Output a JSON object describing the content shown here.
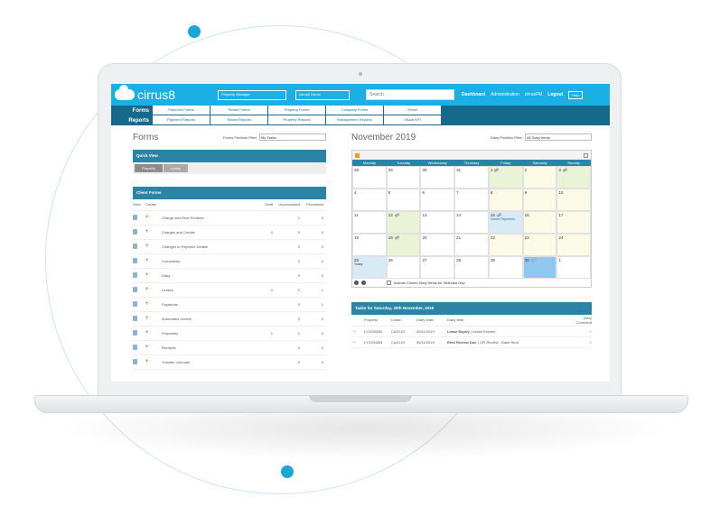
{
  "topbar": {
    "logo": "cirrus8",
    "portfolio_select": "Property Manager",
    "user_select": "cirrus8 Demo",
    "search_placeholder": "Search",
    "nav": [
      "Dashboard",
      "Administration",
      "cirrusFM",
      "Logout"
    ],
    "help": "Help"
  },
  "forms_row": {
    "label": "Forms",
    "items": [
      "Payment Forms",
      "Tenant Forms",
      "Property Forms",
      "Company Forms",
      "Retail"
    ]
  },
  "reports_row": {
    "label": "Reports",
    "items": [
      "Payment Reports",
      "Tenant Reports",
      "Property Reports",
      "Management Reports",
      "Visual KPI"
    ]
  },
  "left": {
    "title": "Forms",
    "filter_label": "Forms Portfolio Filter",
    "filter_value": "My Tasks",
    "quick_view": "Quick View",
    "tabs": [
      "Property",
      "Lease"
    ],
    "client_forms": "Client Forms",
    "headers": [
      "View",
      "Create",
      "Draft",
      "Unprocessed",
      "Processed"
    ],
    "rows": [
      {
        "name": "Charge and Rent Reviews",
        "draft": "",
        "unprocessed": "1",
        "processed": "0"
      },
      {
        "name": "Charges and Credits",
        "draft": "0",
        "unprocessed": "0",
        "processed": "0"
      },
      {
        "name": "Changes to Payment Details",
        "draft": "",
        "unprocessed": "0",
        "processed": "0"
      },
      {
        "name": "Companies",
        "draft": "",
        "unprocessed": "0",
        "processed": "0"
      },
      {
        "name": "Diary",
        "draft": "",
        "unprocessed": "0",
        "processed": "0"
      },
      {
        "name": "Leases",
        "draft": "2",
        "unprocessed": "2",
        "processed": "1"
      },
      {
        "name": "Payments",
        "draft": "",
        "unprocessed": "0",
        "processed": "1"
      },
      {
        "name": "Automated Invoice",
        "draft": "",
        "unprocessed": "0",
        "processed": "0"
      },
      {
        "name": "Properties",
        "draft": "1",
        "unprocessed": "1",
        "processed": "0"
      },
      {
        "name": "Receipts",
        "draft": "",
        "unprocessed": "0",
        "processed": "0"
      },
      {
        "name": "Transfer Journals",
        "draft": "",
        "unprocessed": "0",
        "processed": "0"
      }
    ]
  },
  "right": {
    "title": "November 2019",
    "filter_label": "Diary Portfolio Filter",
    "filter_value": "All Diary Items",
    "days": [
      "Monday",
      "Tuesday",
      "Wednesday",
      "Thursday",
      "Friday",
      "Saturday",
      "Sunday"
    ],
    "weeks": [
      [
        "28",
        "29",
        "30",
        "31",
        "1",
        "2",
        "3"
      ],
      [
        "4",
        "5",
        "6",
        "7",
        "8",
        "9",
        "10"
      ],
      [
        "11",
        "12",
        "13",
        "14",
        "15",
        "16",
        "17"
      ],
      [
        "18",
        "19",
        "20",
        "21",
        "22",
        "23",
        "24"
      ],
      [
        "25",
        "26",
        "27",
        "28",
        "29",
        "30",
        "1"
      ]
    ],
    "today_label": "Today",
    "event_label": "Owner Payments",
    "closed_label": "Include Closed Diary Items for Selected Day",
    "tasks_title": "Tasks for Saturday, 30th November, 2019",
    "task_headers": [
      "Property",
      "Lease",
      "Diary Date",
      "Diary Item",
      "Diary Comment"
    ],
    "tasks": [
      {
        "property": "LYGON264",
        "lease": "CAS123",
        "date": "30/11/2019",
        "item": "Lease Expiry",
        "detail": "Lease Expires"
      },
      {
        "property": "LYGON264",
        "lease": "CAS123",
        "date": "30/11/2019",
        "item": "Rent Review Due",
        "detail": "CPI Review - Base Rent"
      }
    ]
  }
}
